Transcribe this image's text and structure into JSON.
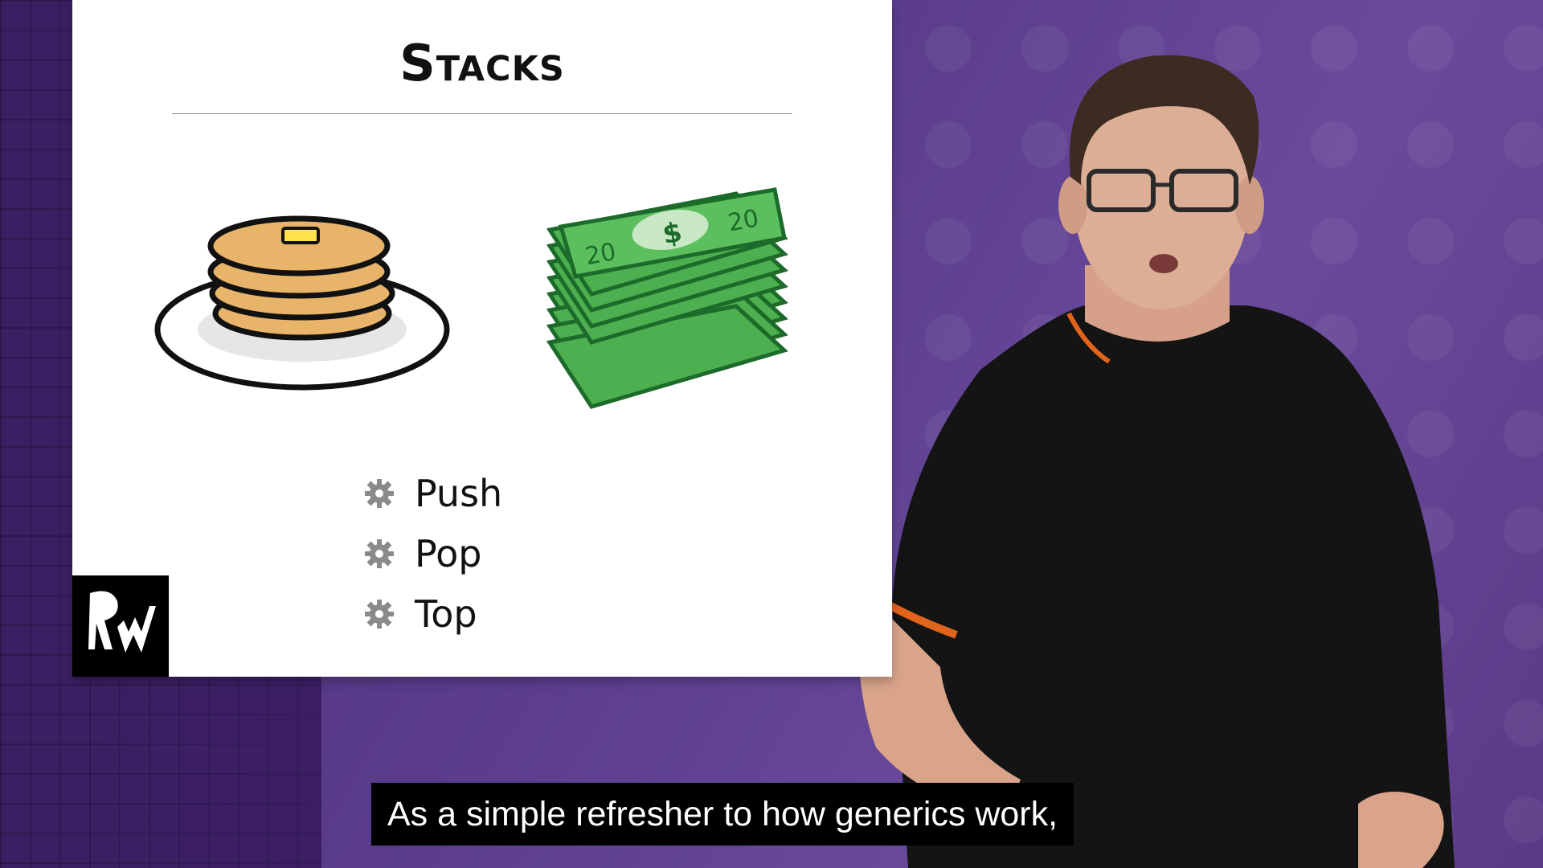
{
  "slide": {
    "title": "Stacks",
    "bullets": [
      {
        "label": "Push",
        "icon": "gear-icon"
      },
      {
        "label": "Pop",
        "icon": "gear-icon"
      },
      {
        "label": "Top",
        "icon": "gear-icon"
      }
    ],
    "money": {
      "note_left": "20",
      "note_right": "20",
      "symbol": "$"
    }
  },
  "caption": {
    "text": "As a simple refresher to how generics work,"
  },
  "colors": {
    "background": "#5b3d8c",
    "slide": "#ffffff",
    "money_green": "#4caf50",
    "pancake": "#e8b46a",
    "caption_bg": "#000000"
  }
}
